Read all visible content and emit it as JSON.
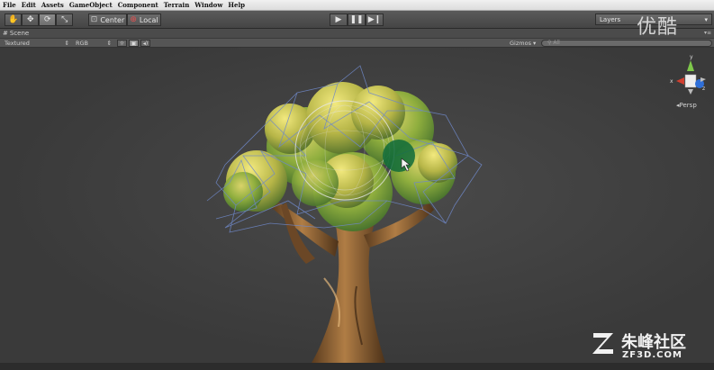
{
  "menu": [
    "File",
    "Edit",
    "Assets",
    "GameObject",
    "Component",
    "Terrain",
    "Window",
    "Help"
  ],
  "toolbar": {
    "pivot_label": "Center",
    "space_label": "Local",
    "layers_label": "Layers"
  },
  "scene_tab": {
    "label": "Scene"
  },
  "scene_controls": {
    "render_mode": "Textured",
    "color_mode": "RGB",
    "gizmos_label": "Gizmos",
    "search_placeholder": "All"
  },
  "gizmo": {
    "persp_label": "Persp",
    "x_label": "x",
    "y_label": "y",
    "z_label": "z"
  },
  "watermark": {
    "top": "优酷",
    "logo_text": "朱峰社区",
    "logo_sub": "ZF3D.COM"
  }
}
